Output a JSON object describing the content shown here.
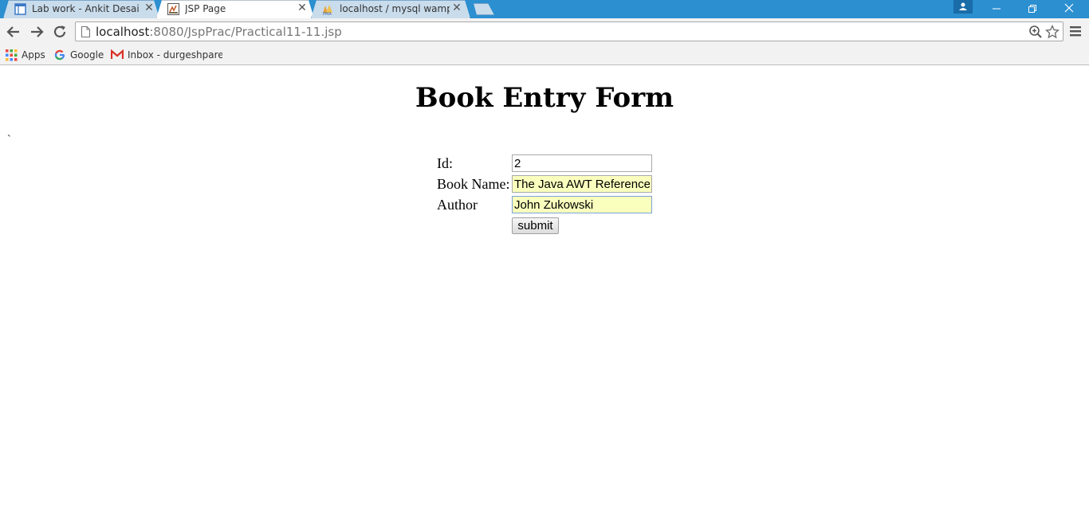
{
  "browser": {
    "tabs": [
      {
        "title": "Lab work - Ankit Desai",
        "active": false,
        "icon": "doc-icon"
      },
      {
        "title": "JSP Page",
        "active": true,
        "icon": "jsp-icon"
      },
      {
        "title": "localhost / mysql wampse",
        "active": false,
        "icon": "phpmyadmin-icon"
      }
    ],
    "address": {
      "host": "localhost",
      "path": ":8080/JspPrac/Practical11-11.jsp"
    },
    "bookmarks": [
      {
        "label": "Apps",
        "icon": "apps-grid-icon"
      },
      {
        "label": "Google",
        "icon": "google-icon"
      },
      {
        "label": "Inbox - durgeshparek",
        "icon": "gmail-icon"
      }
    ],
    "colors": {
      "tabstrip": "#2b8fd0",
      "toolbar": "#f2f2f2",
      "autofill": "#faffbd"
    }
  },
  "page": {
    "heading": "Book Entry Form",
    "stray_text": "`",
    "form": {
      "id_label": "Id:",
      "id_value": "2",
      "book_name_label": "Book Name:",
      "book_name_value": "The Java AWT Reference",
      "author_label": "Author",
      "author_value": "John Zukowski",
      "submit_label": "submit"
    }
  }
}
